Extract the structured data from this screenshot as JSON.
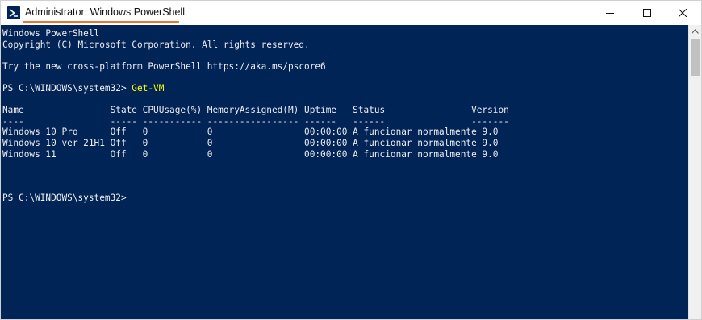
{
  "window": {
    "title": "Administrator: Windows PowerShell",
    "icon": "powershell-icon",
    "controls": {
      "minimize_icon": "minimize-icon",
      "maximize_icon": "maximize-icon",
      "close_icon": "close-icon"
    },
    "accent_underline_color": "#e8772e"
  },
  "console": {
    "background_color": "#012456",
    "text_color": "#eeedf0",
    "command_color": "#ffff00",
    "header_lines": [
      "Windows PowerShell",
      "Copyright (C) Microsoft Corporation. All rights reserved.",
      "",
      "Try the new cross-platform PowerShell https://aka.ms/pscore6",
      ""
    ],
    "prompt_1": "PS C:\\WINDOWS\\system32> ",
    "command_1": "Get-VM",
    "table": {
      "header": "Name                State CPUUsage(%) MemoryAssigned(M) Uptime   Status                Version",
      "separator": "----                ----- ----------- ----------------- ------   ------                -------",
      "rows": [
        "Windows 10 Pro      Off   0           0                 00:00:00 A funcionar normalmente 9.0",
        "Windows 10 ver 21H1 Off   0           0                 00:00:00 A funcionar normalmente 9.0",
        "Windows 11          Off   0           0                 00:00:00 A funcionar normalmente 9.0"
      ]
    },
    "prompt_2": "PS C:\\WINDOWS\\system32>"
  },
  "scrollbar": {
    "up_icon": "scroll-up-arrow-icon"
  }
}
